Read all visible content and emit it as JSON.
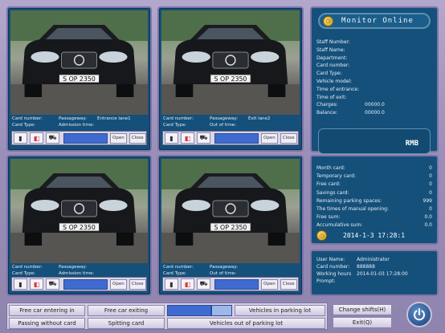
{
  "monitor": {
    "title": "Monitor Online",
    "fields": [
      {
        "label": "Staff Number:",
        "value": ""
      },
      {
        "label": "Staff Name:",
        "value": ""
      },
      {
        "label": "Department:",
        "value": ""
      },
      {
        "label": "Card number:",
        "value": ""
      },
      {
        "label": "Card Type:",
        "value": ""
      },
      {
        "label": "Vehicle model:",
        "value": ""
      },
      {
        "label": "Time of entrance:",
        "value": ""
      },
      {
        "label": "Time of exit:",
        "value": ""
      },
      {
        "label": "Charges:",
        "value": "00000.0"
      },
      {
        "label": "Balance:",
        "value": "00000.0"
      }
    ],
    "currency": "RMB"
  },
  "lanes": [
    {
      "card_number_label": "Card number:",
      "card_type_label": "Card Type:",
      "passageway_label": "Passageway:",
      "passageway_value": "Entrance lane1",
      "time_label": "Admission time:",
      "plate_text": "S OP 2350",
      "open": "Open",
      "close": "Close"
    },
    {
      "card_number_label": "Card number:",
      "card_type_label": "Card Type:",
      "passageway_label": "Passageway:",
      "passageway_value": "Exit lane2",
      "time_label": "Out of time:",
      "plate_text": "S OP 2350",
      "open": "Open",
      "close": "Close"
    },
    {
      "card_number_label": "Card number:",
      "card_type_label": "Card Type:",
      "passageway_label": "Passageway:",
      "passageway_value": "",
      "time_label": "Admission time:",
      "plate_text": "S OP 2350",
      "open": "Open",
      "close": "Close"
    },
    {
      "card_number_label": "Card number:",
      "card_type_label": "Card Type:",
      "passageway_label": "Passageway:",
      "passageway_value": "",
      "time_label": "Out of time:",
      "plate_text": "S OP 2350",
      "open": "Open",
      "close": "Close"
    }
  ],
  "stats": {
    "rows": [
      {
        "label": "Month card:",
        "value": "0"
      },
      {
        "label": "Temporary card:",
        "value": "0"
      },
      {
        "label": "Free card:",
        "value": "0"
      },
      {
        "label": "Savings card:",
        "value": "0"
      },
      {
        "label": "Remaining parking spaces:",
        "value": "999"
      },
      {
        "label": "The times of manual opening:",
        "value": "0"
      },
      {
        "label": "Free sum:",
        "value": "0.0"
      },
      {
        "label": "Accumulative sum:",
        "value": "0.0"
      }
    ],
    "datetime": "2014-1-3 17:28:1"
  },
  "user": {
    "rows": [
      {
        "label": "User Name:",
        "value": "Administrator"
      },
      {
        "label": "Card number:",
        "value": "888888"
      },
      {
        "label": "Working hours",
        "value": "2014-01-03 17:28:00"
      },
      {
        "label": "Prompt:",
        "value": ""
      }
    ]
  },
  "toolbar": {
    "free_car_entering": "Free car entering in",
    "free_car_exiting": "Free car exiting",
    "vehicles_in": "Vehicles in parking lot",
    "passing_without_card": "Passing without card",
    "spitting_card": "Spitting card",
    "vehicles_out": "Vehicles out of parking lot",
    "change_shifts": "Change shifts(H)",
    "exit": "Exit(Q)"
  },
  "colors": {
    "panel": "#14507a",
    "frame": "#9b90b6",
    "accent_blue": "#3f6bd0"
  }
}
